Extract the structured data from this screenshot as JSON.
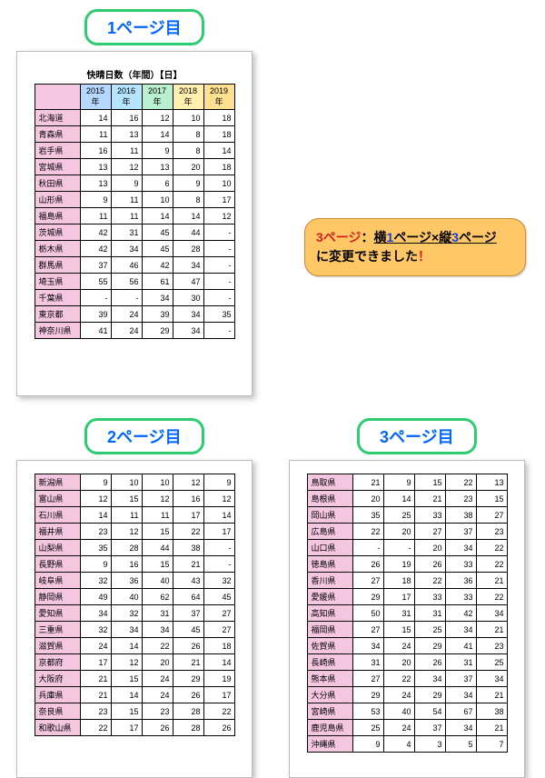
{
  "labels": {
    "p1": "1ページ目",
    "p2": "2ページ目",
    "p3": "3ページ目"
  },
  "callout": {
    "t1": "3",
    "t2": "ページ",
    "t3": "：",
    "t4": "横",
    "t5": "1",
    "t6": "ページ×縦",
    "t7": "3",
    "t8": "ページ",
    "t9": "に変更できました",
    "t10": "！"
  },
  "table_title": "快晴日数（年間）【日】",
  "years": [
    "2015年",
    "2016年",
    "2017年",
    "2018年",
    "2019年"
  ],
  "chart_data": {
    "type": "table",
    "title": "快晴日数（年間）【日】",
    "columns": [
      "2015年",
      "2016年",
      "2017年",
      "2018年",
      "2019年"
    ],
    "pages": [
      {
        "rows": [
          {
            "name": "北海道",
            "v": [
              "14",
              "16",
              "12",
              "10",
              "18"
            ]
          },
          {
            "name": "青森県",
            "v": [
              "11",
              "13",
              "14",
              "8",
              "18"
            ]
          },
          {
            "name": "岩手県",
            "v": [
              "16",
              "11",
              "9",
              "8",
              "14"
            ]
          },
          {
            "name": "宮城県",
            "v": [
              "13",
              "12",
              "13",
              "20",
              "18"
            ]
          },
          {
            "name": "秋田県",
            "v": [
              "13",
              "9",
              "6",
              "9",
              "10"
            ]
          },
          {
            "name": "山形県",
            "v": [
              "9",
              "11",
              "10",
              "8",
              "17"
            ]
          },
          {
            "name": "福島県",
            "v": [
              "11",
              "11",
              "14",
              "14",
              "12"
            ]
          },
          {
            "name": "茨城県",
            "v": [
              "42",
              "31",
              "45",
              "44",
              "-"
            ]
          },
          {
            "name": "栃木県",
            "v": [
              "42",
              "34",
              "45",
              "28",
              "-"
            ]
          },
          {
            "name": "群馬県",
            "v": [
              "37",
              "46",
              "42",
              "34",
              "-"
            ]
          },
          {
            "name": "埼玉県",
            "v": [
              "55",
              "56",
              "61",
              "47",
              "-"
            ]
          },
          {
            "name": "千葉県",
            "v": [
              "-",
              "-",
              "34",
              "30",
              "-"
            ]
          },
          {
            "name": "東京都",
            "v": [
              "39",
              "24",
              "39",
              "34",
              "35"
            ]
          },
          {
            "name": "神奈川県",
            "v": [
              "41",
              "24",
              "29",
              "34",
              "-"
            ]
          }
        ]
      },
      {
        "rows": [
          {
            "name": "新潟県",
            "v": [
              "9",
              "10",
              "10",
              "12",
              "9"
            ]
          },
          {
            "name": "富山県",
            "v": [
              "12",
              "15",
              "12",
              "16",
              "12"
            ]
          },
          {
            "name": "石川県",
            "v": [
              "14",
              "11",
              "11",
              "17",
              "14"
            ]
          },
          {
            "name": "福井県",
            "v": [
              "23",
              "12",
              "15",
              "22",
              "17"
            ]
          },
          {
            "name": "山梨県",
            "v": [
              "35",
              "28",
              "44",
              "38",
              "-"
            ]
          },
          {
            "name": "長野県",
            "v": [
              "9",
              "16",
              "15",
              "21",
              "-"
            ]
          },
          {
            "name": "岐阜県",
            "v": [
              "32",
              "36",
              "40",
              "43",
              "32"
            ]
          },
          {
            "name": "静岡県",
            "v": [
              "49",
              "40",
              "62",
              "64",
              "45"
            ]
          },
          {
            "name": "愛知県",
            "v": [
              "34",
              "32",
              "31",
              "37",
              "27"
            ]
          },
          {
            "name": "三重県",
            "v": [
              "32",
              "34",
              "34",
              "45",
              "27"
            ]
          },
          {
            "name": "滋賀県",
            "v": [
              "24",
              "14",
              "22",
              "26",
              "18"
            ]
          },
          {
            "name": "京都府",
            "v": [
              "17",
              "12",
              "20",
              "21",
              "14"
            ]
          },
          {
            "name": "大阪府",
            "v": [
              "21",
              "15",
              "24",
              "29",
              "19"
            ]
          },
          {
            "name": "兵庫県",
            "v": [
              "21",
              "14",
              "24",
              "26",
              "17"
            ]
          },
          {
            "name": "奈良県",
            "v": [
              "23",
              "15",
              "23",
              "28",
              "22"
            ]
          },
          {
            "name": "和歌山県",
            "v": [
              "22",
              "17",
              "26",
              "28",
              "26"
            ]
          }
        ]
      },
      {
        "rows": [
          {
            "name": "鳥取県",
            "v": [
              "21",
              "9",
              "15",
              "22",
              "13"
            ]
          },
          {
            "name": "島根県",
            "v": [
              "20",
              "14",
              "21",
              "23",
              "15"
            ]
          },
          {
            "name": "岡山県",
            "v": [
              "35",
              "25",
              "33",
              "38",
              "27"
            ]
          },
          {
            "name": "広島県",
            "v": [
              "22",
              "20",
              "27",
              "37",
              "23"
            ]
          },
          {
            "name": "山口県",
            "v": [
              "-",
              "-",
              "20",
              "34",
              "22"
            ]
          },
          {
            "name": "徳島県",
            "v": [
              "26",
              "19",
              "26",
              "33",
              "22"
            ]
          },
          {
            "name": "香川県",
            "v": [
              "27",
              "18",
              "22",
              "36",
              "21"
            ]
          },
          {
            "name": "愛媛県",
            "v": [
              "29",
              "17",
              "33",
              "33",
              "22"
            ]
          },
          {
            "name": "高知県",
            "v": [
              "50",
              "31",
              "31",
              "42",
              "34"
            ]
          },
          {
            "name": "福岡県",
            "v": [
              "27",
              "15",
              "25",
              "34",
              "21"
            ]
          },
          {
            "name": "佐賀県",
            "v": [
              "34",
              "24",
              "29",
              "41",
              "23"
            ]
          },
          {
            "name": "長崎県",
            "v": [
              "31",
              "20",
              "26",
              "31",
              "25"
            ]
          },
          {
            "name": "熊本県",
            "v": [
              "27",
              "22",
              "34",
              "37",
              "34"
            ]
          },
          {
            "name": "大分県",
            "v": [
              "29",
              "24",
              "29",
              "34",
              "21"
            ]
          },
          {
            "name": "宮崎県",
            "v": [
              "53",
              "40",
              "54",
              "67",
              "38"
            ]
          },
          {
            "name": "鹿児島県",
            "v": [
              "25",
              "24",
              "37",
              "34",
              "21"
            ]
          },
          {
            "name": "沖縄県",
            "v": [
              "9",
              "4",
              "3",
              "5",
              "7"
            ]
          }
        ]
      }
    ]
  }
}
